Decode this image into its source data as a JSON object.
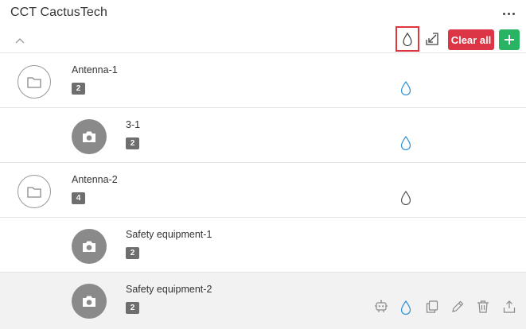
{
  "header": {
    "title": "CCT CactusTech",
    "clear_all_label": "Clear all"
  },
  "colors": {
    "accent_red": "#dc3545",
    "accent_green": "#28b463",
    "drop_blue": "#2a8fd6",
    "highlight_border": "#e0353c"
  },
  "icons": {
    "more": "more-vertical-dots-icon",
    "collapse": "chevron-up-icon",
    "toolbar_drop": "water-drop-icon",
    "export": "arrow-down-left-icon",
    "add": "plus-icon",
    "folder": "folder-icon",
    "camera": "camera-icon",
    "robot": "robot-icon",
    "copy": "copy-icon",
    "edit": "pencil-icon",
    "delete": "trash-icon",
    "share": "upload-icon"
  },
  "items": [
    {
      "name": "Antenna-1",
      "count": "2",
      "type": "folder",
      "drop_color": "blue"
    },
    {
      "name": "3-1",
      "count": "2",
      "type": "camera",
      "drop_color": "blue"
    },
    {
      "name": "Antenna-2",
      "count": "4",
      "type": "folder",
      "drop_color": "gray"
    },
    {
      "name": "Safety equipment-1",
      "count": "2",
      "type": "camera",
      "drop_color": "none"
    },
    {
      "name": "Safety equipment-2",
      "count": "2",
      "type": "camera",
      "drop_color": "blue",
      "highlighted": true
    }
  ]
}
